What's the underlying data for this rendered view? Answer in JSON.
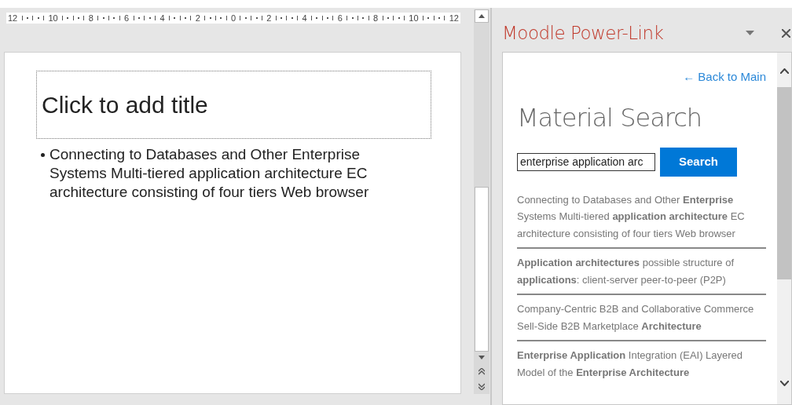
{
  "ruler": {
    "labels": [
      "12",
      "10",
      "8",
      "6",
      "4",
      "2",
      "0",
      "2",
      "4",
      "6",
      "8",
      "10",
      "12"
    ]
  },
  "slide": {
    "title_placeholder": "Click to add title",
    "bullets": [
      "Connecting to Databases and Other Enterprise Systems Multi-tiered application architecture EC architecture consisting of four tiers Web browser"
    ]
  },
  "task_pane": {
    "title": "Moodle Power-Link",
    "back_link": "← Back to Main",
    "heading": "Material Search",
    "search": {
      "value": "enterprise application arc",
      "button": "Search"
    },
    "results": [
      "Connecting to Databases and Other **Enterprise** Systems Multi-tiered **application architecture** EC architecture consisting of four tiers Web browser",
      "**Application architectures** possible structure of **applications**: client-server peer-to-peer (P2P)",
      "Company-Centric B2B and Collaborative Commerce Sell-Side B2B Marketplace **Architecture**",
      "**Enterprise Application** Integration (EAI) Layered Model of the **Enterprise Architecture**"
    ]
  }
}
